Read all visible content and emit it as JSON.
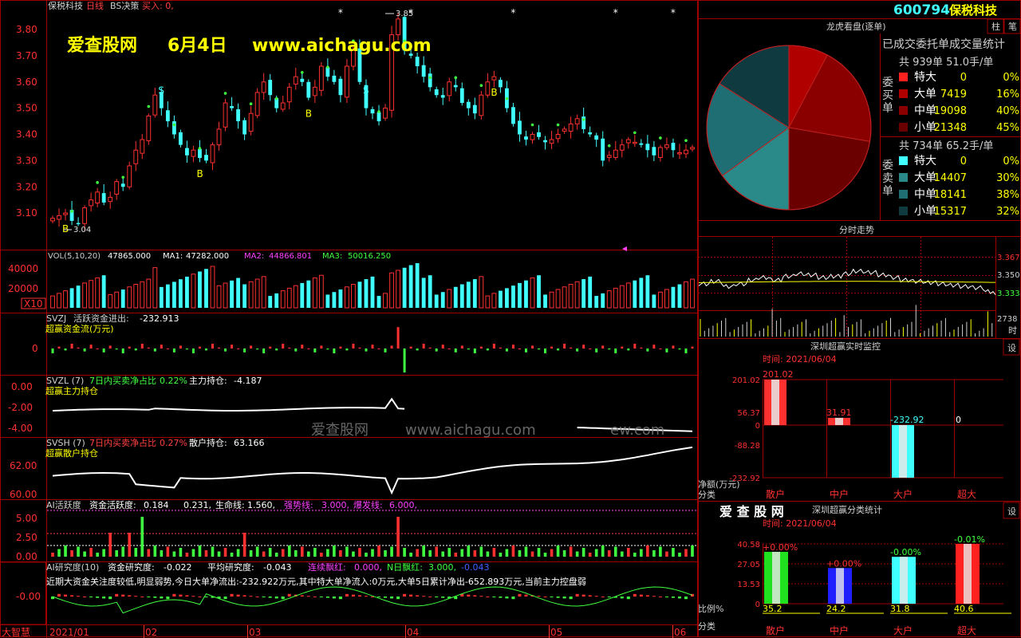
{
  "header": {
    "stock_name": "保税科技",
    "period": "日线",
    "bs_label": "BS决策",
    "buy_label": "买入: 0,",
    "high_annotation": "3.85",
    "low_annotation": "3.04",
    "stock_code": "600794",
    "code_name": "保税科技",
    "btn_zhu": "柱",
    "btn_bi": "笔"
  },
  "watermark": {
    "site": "爱查股网",
    "date": "6月4日",
    "url": "www.aichagu.com",
    "mid_site": "爱查股网",
    "mid_url": "www.aichagu.com",
    "mid_tail": "ew.com",
    "logo": "爱 查 股 网"
  },
  "price_axis": [
    "3.80",
    "3.70",
    "3.60",
    "3.50",
    "3.40",
    "3.30",
    "3.20",
    "3.10"
  ],
  "vol_panel": {
    "title": "VOL(5,10,20)",
    "vol": "47865.000",
    "ma1_label": "MA1:",
    "ma1": "47282.000",
    "ma2_label": "MA2:",
    "ma2": "44866.801",
    "ma3_label": "MA3:",
    "ma3": "50016.250",
    "axis": [
      "40000",
      "20000"
    ],
    "unit": "X10"
  },
  "svzj_panel": {
    "name": "SVZJ",
    "title": "活跃资金进出:",
    "value": "-232.913",
    "subtitle": "超赢资金流(万元)",
    "axis": [
      "0"
    ]
  },
  "svzl_panel": {
    "name": "SVZL (7)",
    "title": "7日内买卖净占比",
    "ratio": "0.22%",
    "label2": "主力持仓:",
    "value": "-4.187",
    "subtitle": "超赢主力持仓",
    "axis": [
      "0.00",
      "-2.00",
      "-4.00"
    ]
  },
  "svsh_panel": {
    "name": "SVSH (7)",
    "title": "7日内买卖净占比",
    "ratio": "0.27%",
    "label2": "散户持仓:",
    "value": "63.166",
    "subtitle": "超赢散户持仓",
    "axis": [
      "62.00",
      "60.00"
    ]
  },
  "ai_panel": {
    "title": "AI活跃度",
    "label1": "资金活跃度:",
    "v1": "0.184",
    "v2": "0.231,",
    "label3": "生命线:",
    "v3": "1.560,",
    "label4": "强势线:",
    "v4": "3.000,",
    "label5": "爆发线:",
    "v5": "6.000,",
    "axis": [
      "5.00",
      "2.50",
      "0.00"
    ]
  },
  "research_panel": {
    "title": "AI研究度(10)",
    "label1": "资金研究度:",
    "v1": "-0.022",
    "label2": "平均研究度:",
    "v2": "-0.043",
    "label3": "连续飘红:",
    "v3": "0.000,",
    "label4": "N日飘红:",
    "v4": "3.000,",
    "v5": "-0.043",
    "comment": "近期大资金关注度较低,明显弱势,今日大单净流出:-232.922万元,其中特大单净流入:0万元,大单5日累计净出-652.893万元,当前主力控盘弱",
    "axis": [
      "-0.00"
    ]
  },
  "date_axis": {
    "corner": "大智慧",
    "labels": [
      "2021/01",
      "02",
      "03",
      "04",
      "05",
      "06"
    ]
  },
  "order_stats": {
    "title": "龙虎看盘(逐单)",
    "subtitle": "已成交委托单成交量统计",
    "buy_side": "委买单",
    "sell_side": "委卖单",
    "buy_total": "共 939单 51.0手/单",
    "sell_total": "共 734单 65.2手/单",
    "buy_rows": [
      {
        "label": "特大",
        "value": "0",
        "pct": "0%"
      },
      {
        "label": "大单",
        "value": "7419",
        "pct": "16%"
      },
      {
        "label": "中单",
        "value": "19098",
        "pct": "40%"
      },
      {
        "label": "小单",
        "value": "21348",
        "pct": "45%"
      }
    ],
    "sell_rows": [
      {
        "label": "特大",
        "value": "0",
        "pct": "0%"
      },
      {
        "label": "大单",
        "value": "14407",
        "pct": "30%"
      },
      {
        "label": "中单",
        "value": "18141",
        "pct": "38%"
      },
      {
        "label": "小单",
        "value": "15317",
        "pct": "32%"
      }
    ]
  },
  "intraday": {
    "title": "分时走势",
    "axis": [
      "3.367",
      "3.350",
      "3.333"
    ],
    "vol_label": "2738",
    "vol_unit": "时"
  },
  "realtime_monitor": {
    "title": "深圳超赢实时监控",
    "btn": "设",
    "time_label": "时间: 2021/06/04",
    "axis": [
      "201.02",
      "56.37",
      "0",
      "-88.28",
      "-232.92"
    ],
    "ylabel": "净额(万元)",
    "cat_label": "分类",
    "categories": [
      "散户",
      "中户",
      "大户",
      "超大"
    ],
    "value_labels": [
      "201.02",
      "31.91",
      "-232.92",
      "0"
    ]
  },
  "class_stats": {
    "title": "深圳超赢分类统计",
    "btn": "设",
    "time_label": "时间: 2021/06/04",
    "axis": [
      "40.58",
      "27.05",
      "13.53",
      "0"
    ],
    "ylabel": "比例%",
    "cat_label": "分类",
    "categories": [
      "散户",
      "中户",
      "大户",
      "超大"
    ],
    "top_labels": [
      "+0.00%",
      "+0.00%",
      "-0.00%",
      "-0.01%"
    ],
    "bottom_labels": [
      "35.2",
      "24.2",
      "31.8",
      "40.6"
    ]
  },
  "chart_data": [
    {
      "type": "pie",
      "title": "龙虎看盘(逐单)",
      "categories": [
        "委买-大单",
        "委买-中单",
        "委买-小单",
        "委卖-大单",
        "委卖-中单",
        "委卖-小单"
      ],
      "values": [
        7419,
        19098,
        21348,
        14407,
        18141,
        15317
      ],
      "colors": [
        "#b00000",
        "#8a0000",
        "#6a0000",
        "#2a8a8a",
        "#1e6e74",
        "#0e3a40"
      ]
    },
    {
      "type": "bar",
      "title": "深圳超赢实时监控",
      "categories": [
        "散户",
        "中户",
        "大户",
        "超大"
      ],
      "values": [
        201.02,
        31.91,
        -232.92,
        0
      ],
      "ylim": [
        -232.92,
        201.02
      ],
      "colors": [
        "#ff3030",
        "#ff3030",
        "#40ffff",
        "#ff3030"
      ]
    },
    {
      "type": "bar",
      "title": "深圳超赢分类统计",
      "categories": [
        "散户",
        "中户",
        "大户",
        "超大"
      ],
      "values": [
        35.2,
        24.2,
        31.8,
        40.6
      ],
      "ylim": [
        0,
        40.58
      ],
      "colors": [
        "#20e020",
        "#2020ff",
        "#40ffff",
        "#ff2020"
      ]
    },
    {
      "type": "candlestick",
      "title": "保税科技 日线",
      "ylim": [
        3.0,
        3.87
      ],
      "x": [
        "2021-01-04",
        "2021-01-05",
        "2021-01-06",
        "2021-01-07",
        "2021-01-08",
        "2021-01-11",
        "2021-01-12",
        "2021-01-13",
        "2021-01-14",
        "2021-01-15",
        "2021-01-18",
        "2021-01-19",
        "2021-01-20",
        "2021-01-21",
        "2021-01-22",
        "2021-01-25",
        "2021-01-26",
        "2021-01-27",
        "2021-01-28",
        "2021-01-29",
        "2021-02-01",
        "2021-02-02",
        "2021-02-03",
        "2021-02-04",
        "2021-02-05",
        "2021-02-08",
        "2021-02-09",
        "2021-02-10",
        "2021-02-18",
        "2021-02-19",
        "2021-02-22",
        "2021-02-23",
        "2021-02-24",
        "2021-02-25",
        "2021-02-26",
        "2021-03-01",
        "2021-03-02",
        "2021-03-03",
        "2021-03-04",
        "2021-03-05",
        "2021-03-08",
        "2021-03-09",
        "2021-03-10",
        "2021-03-11",
        "2021-03-12",
        "2021-03-15",
        "2021-03-16",
        "2021-03-17",
        "2021-03-18",
        "2021-03-19",
        "2021-03-22",
        "2021-03-23",
        "2021-03-24",
        "2021-03-25",
        "2021-03-26",
        "2021-03-29",
        "2021-03-30",
        "2021-03-31",
        "2021-04-01",
        "2021-04-02",
        "2021-04-06",
        "2021-04-07",
        "2021-04-08",
        "2021-04-09",
        "2021-04-12",
        "2021-04-13",
        "2021-04-14",
        "2021-04-15",
        "2021-04-16",
        "2021-04-19",
        "2021-04-20",
        "2021-04-21",
        "2021-04-22",
        "2021-04-23",
        "2021-04-26",
        "2021-04-27",
        "2021-04-28",
        "2021-04-29",
        "2021-04-30",
        "2021-05-06",
        "2021-05-07",
        "2021-05-10",
        "2021-05-11",
        "2021-05-12",
        "2021-05-13",
        "2021-05-14",
        "2021-05-17",
        "2021-05-18",
        "2021-05-19",
        "2021-05-20",
        "2021-05-21",
        "2021-05-24",
        "2021-05-25",
        "2021-05-26",
        "2021-05-27",
        "2021-05-28",
        "2021-05-31",
        "2021-06-01",
        "2021-06-02",
        "2021-06-03",
        "2021-06-04"
      ],
      "close": [
        3.08,
        3.09,
        3.1,
        3.07,
        3.06,
        3.12,
        3.15,
        3.18,
        3.14,
        3.16,
        3.22,
        3.2,
        3.28,
        3.34,
        3.38,
        3.47,
        3.55,
        3.5,
        3.45,
        3.4,
        3.36,
        3.32,
        3.34,
        3.31,
        3.3,
        3.36,
        3.42,
        3.52,
        3.5,
        3.45,
        3.4,
        3.48,
        3.56,
        3.6,
        3.55,
        3.5,
        3.52,
        3.58,
        3.62,
        3.6,
        3.54,
        3.58,
        3.66,
        3.62,
        3.6,
        3.55,
        3.66,
        3.72,
        3.6,
        3.5,
        3.48,
        3.45,
        3.5,
        3.78,
        3.84,
        3.72,
        3.7,
        3.66,
        3.62,
        3.58,
        3.55,
        3.54,
        3.6,
        3.58,
        3.52,
        3.5,
        3.48,
        3.55,
        3.6,
        3.62,
        3.58,
        3.5,
        3.44,
        3.4,
        3.38,
        3.4,
        3.39,
        3.37,
        3.38,
        3.4,
        3.42,
        3.44,
        3.46,
        3.42,
        3.4,
        3.38,
        3.3,
        3.32,
        3.34,
        3.36,
        3.38,
        3.37,
        3.36,
        3.34,
        3.32,
        3.35,
        3.36,
        3.34,
        3.33,
        3.34,
        3.35
      ]
    },
    {
      "type": "line",
      "title": "分时走势",
      "ylim": [
        3.32,
        3.375
      ],
      "values": [
        3.34,
        3.342,
        3.338,
        3.34,
        3.343,
        3.345,
        3.343,
        3.346,
        3.348,
        3.347,
        3.345,
        3.346,
        3.348,
        3.35,
        3.349,
        3.347,
        3.345,
        3.343,
        3.342,
        3.341,
        3.34,
        3.339,
        3.338,
        3.337,
        3.334,
        3.33
      ]
    }
  ]
}
